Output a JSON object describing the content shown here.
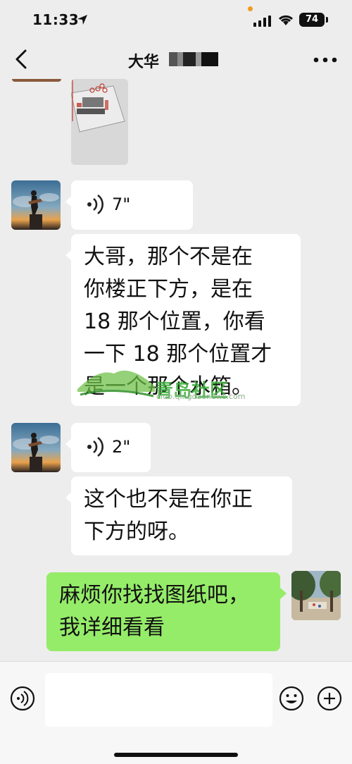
{
  "status": {
    "time": "11:33",
    "battery": "74"
  },
  "nav": {
    "title": "大华"
  },
  "messages": {
    "voice1": {
      "duration": "7\""
    },
    "text1": {
      "lines": [
        "大哥，那个不是在",
        "你楼正下方，是在",
        "18 那个位置，你看",
        "一下 18 那个位置才",
        "是一个那个水箱。"
      ]
    },
    "voice2": {
      "duration": "2\""
    },
    "text2": {
      "lines": [
        "这个也不是在你正",
        "下方的呀。"
      ]
    },
    "text3": {
      "lines": [
        "麻烦你找找图纸吧，",
        "我详细看看"
      ]
    }
  },
  "watermark": {
    "text": "青岛社区",
    "url": "club.qingdaonews.com"
  },
  "input": {
    "placeholder": ""
  },
  "colors": {
    "background": "#ededed",
    "sent_bubble": "#95ec69",
    "received_bubble": "#ffffff"
  },
  "icons": [
    "location-arrow-icon",
    "signal-icon",
    "wifi-icon",
    "back-chevron-icon",
    "more-icon",
    "voice-wave-icon",
    "voice-input-icon",
    "emoji-icon",
    "plus-icon"
  ]
}
